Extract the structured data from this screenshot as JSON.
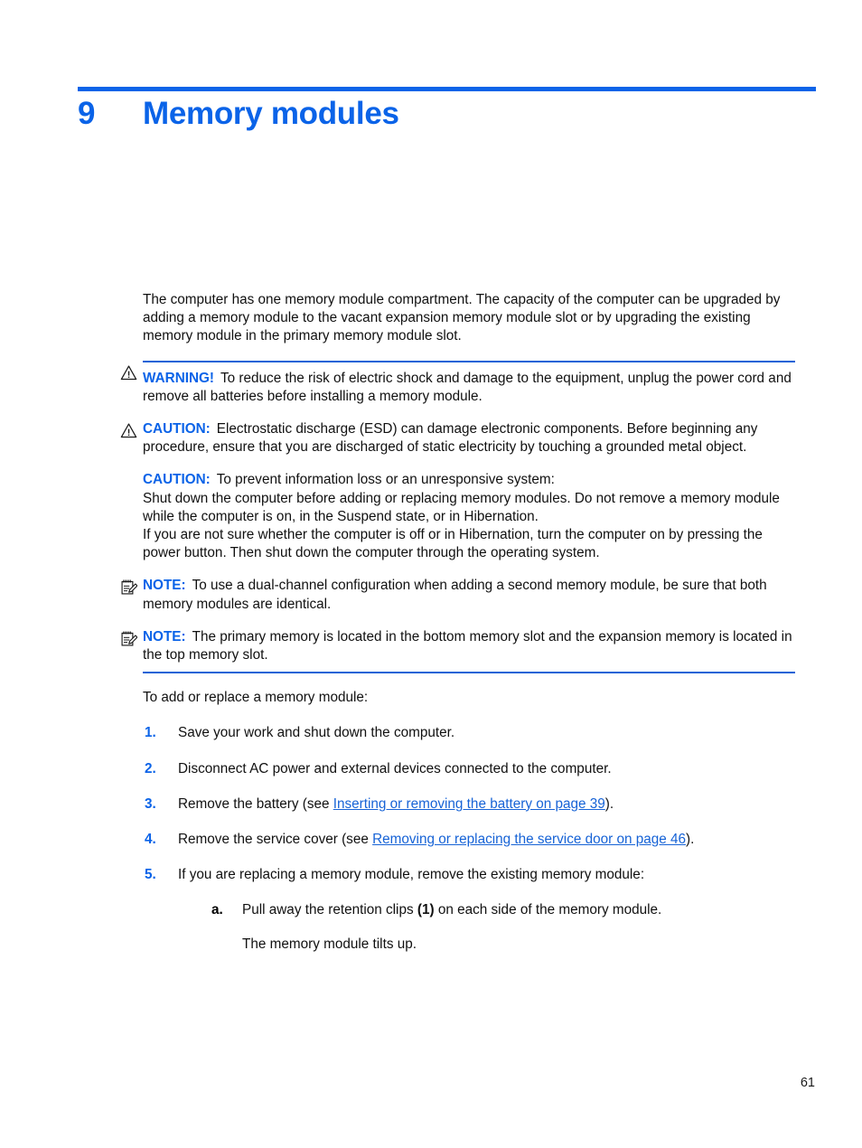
{
  "colors": {
    "accent": "#0a63e8",
    "rule": "#1763d6",
    "link": "#1763d6",
    "text": "#111111"
  },
  "chapter": {
    "number": "9",
    "title": "Memory modules"
  },
  "intro": {
    "paragraph": "The computer has one memory module compartment. The capacity of the computer can be upgraded by adding a memory module to the vacant expansion memory module slot or by upgrading the existing memory module in the primary memory module slot."
  },
  "admonitions": [
    {
      "id": "warning-electric-shock",
      "icon": "warning-triangle-icon",
      "label": "WARNING!",
      "text": "To reduce the risk of electric shock and damage to the equipment, unplug the power cord and remove all batteries before installing a memory module."
    },
    {
      "id": "caution-esd",
      "icon": "warning-triangle-icon",
      "label": "CAUTION:",
      "text": "Electrostatic discharge (ESD) can damage electronic components. Before beginning any procedure, ensure that you are discharged of static electricity by touching a grounded metal object."
    },
    {
      "id": "caution-information-loss",
      "icon": "none",
      "label": "CAUTION:",
      "text": "To prevent information loss or an unresponsive system:"
    },
    {
      "id": "note-dual-channel",
      "icon": "note-pad-icon",
      "label": "NOTE:",
      "text": "To use a dual-channel configuration when adding a second memory module, be sure that both memory modules are identical."
    },
    {
      "id": "note-memory-slots",
      "icon": "note-pad-icon",
      "label": "NOTE:",
      "text": "The primary memory is located in the bottom memory slot and the expansion memory is located in the top memory slot."
    }
  ],
  "caution_body": {
    "paragraph_1": "Shut down the computer before adding or replacing memory modules. Do not remove a memory module while the computer is on, in the Suspend state, or in Hibernation.",
    "paragraph_2": "If you are not sure whether the computer is off or in Hibernation, turn the computer on by pressing the power button. Then shut down the computer through the operating system."
  },
  "procedure": {
    "lead_in": "To add or replace a memory module:",
    "steps": [
      {
        "marker": "1.",
        "text": "Save your work and shut down the computer."
      },
      {
        "marker": "2.",
        "text": "Disconnect AC power and external devices connected to the computer."
      },
      {
        "marker": "3.",
        "text_before": "Remove the battery (see ",
        "link": "Inserting or removing the battery on page 39",
        "text_after": ")."
      },
      {
        "marker": "4.",
        "text_before": "Remove the service cover (see ",
        "link": "Removing or replacing the service door on page 46",
        "text_after": ")."
      },
      {
        "marker": "5.",
        "text": "If you are replacing a memory module, remove the existing memory module:",
        "substeps": [
          {
            "marker": "a.",
            "text_before": "Pull away the retention clips ",
            "bold": "(1)",
            "text_after": " on each side of the memory module."
          }
        ],
        "follow_up": "The memory module tilts up."
      }
    ]
  },
  "footer": {
    "page_number": "61"
  }
}
